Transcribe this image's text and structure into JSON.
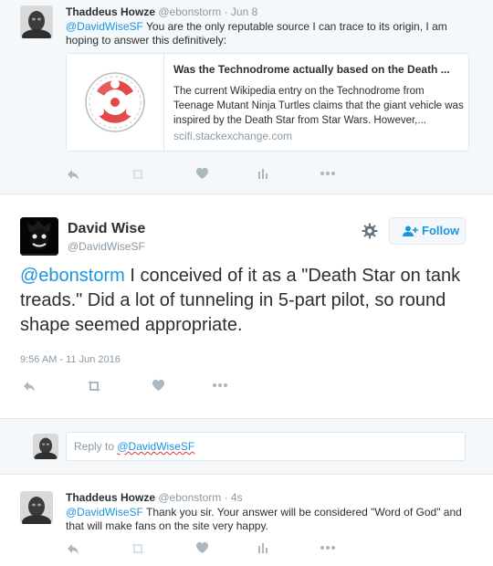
{
  "tweet1": {
    "name": "Thaddeus Howze",
    "handle": "@ebonstorm",
    "time": "· Jun 8",
    "mention": "@DavidWiseSF",
    "text": " You are the only reputable source I can trace to its origin, I am hoping to answer this definitively:",
    "card": {
      "title": "Was the Technodrome actually based on the Death ...",
      "description": "The current Wikipedia entry on the Technodrome from Teenage Mutant Ninja Turtles claims that the giant vehicle was inspired by the Death Star from Star Wars. However,...",
      "domain": "scifi.stackexchange.com"
    },
    "retweet_count": "",
    "like_count": ""
  },
  "main_tweet": {
    "name": "David Wise",
    "handle": "@DavidWiseSF",
    "follow_label": "Follow",
    "mention": "@ebonstorm",
    "text": " I conceived of it as a \"Death Star on tank treads.\" Did a lot of tunneling in 5-part pilot, so round shape seemed appropriate.",
    "timestamp": "9:56 AM - 11 Jun 2016"
  },
  "reply_box": {
    "prefix": "Reply to ",
    "mention": "@DavidWiseSF"
  },
  "tweet2": {
    "name": "Thaddeus Howze",
    "handle": "@ebonstorm",
    "time": "· 4s",
    "mention": "@DavidWiseSF",
    "text": " Thank you sir. Your answer will be considered \"Word of God\" and that will make fans on the site very happy."
  },
  "colors": {
    "accent": "#1b95e0",
    "muted": "#8899a6",
    "icon": "#aab8c2",
    "soft_bg": "#f5f8fa",
    "border": "#e1e8ed"
  },
  "icons": {
    "reply": "reply-icon",
    "retweet": "retweet-icon",
    "like": "heart-icon",
    "analytics": "bar-chart-icon",
    "more": "more-dots-icon",
    "settings": "gear-icon",
    "follow": "add-user-icon"
  }
}
